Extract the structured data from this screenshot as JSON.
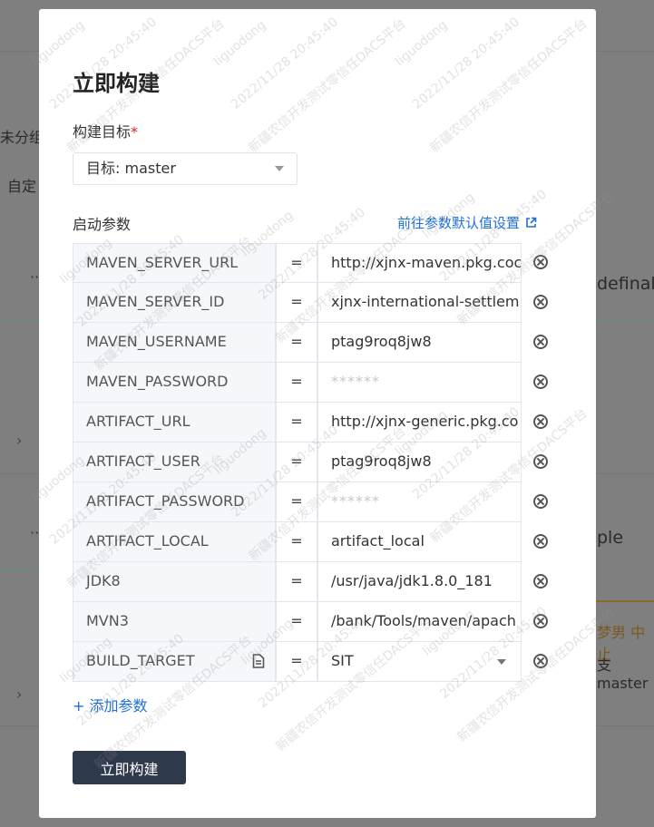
{
  "background": {
    "frag_unassigned": "未分组",
    "frag_custom": "自定",
    "frag_definal": "definal",
    "frag_ple": "ple",
    "frag_user": "梦男 中止",
    "frag_branch": "支 master"
  },
  "modal": {
    "title": "立即构建",
    "target_label": "构建目标",
    "required_mark": "*",
    "target_prefix": "目标:",
    "target_value": "master",
    "params_label": "启动参数",
    "defaults_link": "前往参数默认值设置",
    "add_param": "+ 添加参数",
    "build_button": "立即构建"
  },
  "params": [
    {
      "key": "MAVEN_SERVER_URL",
      "eq": "=",
      "value": "http://xjnx-maven.pkg.coc"
    },
    {
      "key": "MAVEN_SERVER_ID",
      "eq": "=",
      "value": "xjnx-international-settlem"
    },
    {
      "key": "MAVEN_USERNAME",
      "eq": "=",
      "value": "ptag9roq8jw8"
    },
    {
      "key": "MAVEN_PASSWORD",
      "eq": "=",
      "value": "******"
    },
    {
      "key": "ARTIFACT_URL",
      "eq": "=",
      "value": "http://xjnx-generic.pkg.co"
    },
    {
      "key": "ARTIFACT_USER",
      "eq": "=",
      "value": "ptag9roq8jw8"
    },
    {
      "key": "ARTIFACT_PASSWORD",
      "eq": "=",
      "value": "******"
    },
    {
      "key": "ARTIFACT_LOCAL",
      "eq": "=",
      "value": "artifact_local"
    },
    {
      "key": "JDK8",
      "eq": "=",
      "value": "/usr/java/jdk1.8.0_181"
    },
    {
      "key": "MVN3",
      "eq": "=",
      "value": "/bank/Tools/maven/apach"
    },
    {
      "key": "BUILD_TARGET",
      "eq": "=",
      "value": "SIT"
    }
  ],
  "watermark": {
    "user": "liguodong",
    "time": "2022/11/28 20:45:40",
    "org": "新疆农信开发测试零信任DACS平台"
  },
  "colors": {
    "link": "#1e6fd9",
    "primary_button": "#2e3a4c",
    "required": "#e02020"
  }
}
